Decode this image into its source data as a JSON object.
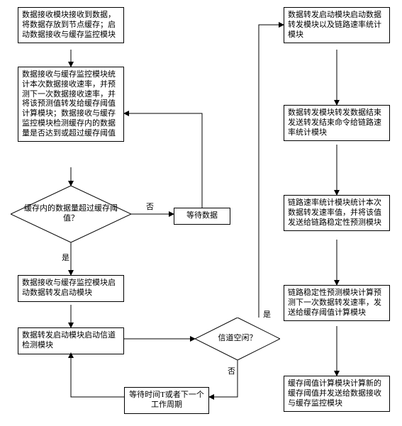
{
  "flow": {
    "left": {
      "recv_store": "数据接收模块接收到数据，将数据存放到节点缓存；启动数据接收与缓存监控模块",
      "monitor": "数据接收与缓存监控模块统计本次数据接收速率，并预测下一次数据接收速率，并将该预测值转发给缓存阈值计算模块；数据接收与缓存监控模块检测缓存内的数据量是否达到或超过缓存阈值",
      "threshold_q": "缓存内的数据量超过缓存阈值？",
      "start_forward": "数据接收与缓存监控模块启动数据转发启动模块",
      "start_channel_detect": "数据转发启动模块启动信道检测模块",
      "wait_T": "等待时间T或者下一个工作周期"
    },
    "mid": {
      "wait_data": "等待数据",
      "channel_idle_q": "信道空闲？"
    },
    "right": {
      "start_modules": "数据转发启动模块启动数据转发模块以及链路速率统计模块",
      "forward_end": "数据转发模块转发数据结束发送转发结束命令给链路速率统计模块",
      "stat_rate": "链路速率统计模块统计本次数据转发速率值，并将该值发送给链路稳定性预测模块",
      "predict_next": "链路稳定性预测模块计算预测下一次数据转发速率，发送给缓存阈值计算模块",
      "calc_threshold": "缓存阈值计算模块计算新的缓存阈值并发送给数据接收与缓存监控模块"
    },
    "labels": {
      "yes": "是",
      "no": "否"
    }
  },
  "chart_data": {
    "type": "flowchart",
    "nodes": [
      {
        "id": "recv_store",
        "type": "process",
        "text": "数据接收模块接收到数据，将数据存放到节点缓存；启动数据接收与缓存监控模块"
      },
      {
        "id": "monitor",
        "type": "process",
        "text": "数据接收与缓存监控模块统计本次数据接收速率，并预测下一次数据接收速率，并将该预测值转发给缓存阈值计算模块；数据接收与缓存监控模块检测缓存内的数据量是否达到或超过缓存阈值"
      },
      {
        "id": "threshold_q",
        "type": "decision",
        "text": "缓存内的数据量超过缓存阈值？"
      },
      {
        "id": "wait_data",
        "type": "process",
        "text": "等待数据"
      },
      {
        "id": "start_forward",
        "type": "process",
        "text": "数据接收与缓存监控模块启动数据转发启动模块"
      },
      {
        "id": "start_channel_detect",
        "type": "process",
        "text": "数据转发启动模块启动信道检测模块"
      },
      {
        "id": "channel_idle_q",
        "type": "decision",
        "text": "信道空闲？"
      },
      {
        "id": "wait_T",
        "type": "process",
        "text": "等待时间T或者下一个工作周期"
      },
      {
        "id": "start_modules",
        "type": "process",
        "text": "数据转发启动模块启动数据转发模块以及链路速率统计模块"
      },
      {
        "id": "forward_end",
        "type": "process",
        "text": "数据转发模块转发数据结束发送转发结束命令给链路速率统计模块"
      },
      {
        "id": "stat_rate",
        "type": "process",
        "text": "链路速率统计模块统计本次数据转发速率值，并将该值发送给链路稳定性预测模块"
      },
      {
        "id": "predict_next",
        "type": "process",
        "text": "链路稳定性预测模块计算预测下一次数据转发速率，发送给缓存阈值计算模块"
      },
      {
        "id": "calc_threshold",
        "type": "process",
        "text": "缓存阈值计算模块计算新的缓存阈值并发送给数据接收与缓存监控模块"
      }
    ],
    "edges": [
      {
        "from": "recv_store",
        "to": "monitor"
      },
      {
        "from": "monitor",
        "to": "threshold_q"
      },
      {
        "from": "threshold_q",
        "to": "wait_data",
        "label": "否"
      },
      {
        "from": "wait_data",
        "to": "monitor"
      },
      {
        "from": "threshold_q",
        "to": "start_forward",
        "label": "是"
      },
      {
        "from": "start_forward",
        "to": "start_channel_detect"
      },
      {
        "from": "start_channel_detect",
        "to": "channel_idle_q"
      },
      {
        "from": "channel_idle_q",
        "to": "wait_T",
        "label": "否"
      },
      {
        "from": "wait_T",
        "to": "start_channel_detect"
      },
      {
        "from": "channel_idle_q",
        "to": "start_modules",
        "label": "是"
      },
      {
        "from": "start_modules",
        "to": "forward_end"
      },
      {
        "from": "forward_end",
        "to": "stat_rate"
      },
      {
        "from": "stat_rate",
        "to": "predict_next"
      },
      {
        "from": "predict_next",
        "to": "calc_threshold"
      }
    ]
  }
}
